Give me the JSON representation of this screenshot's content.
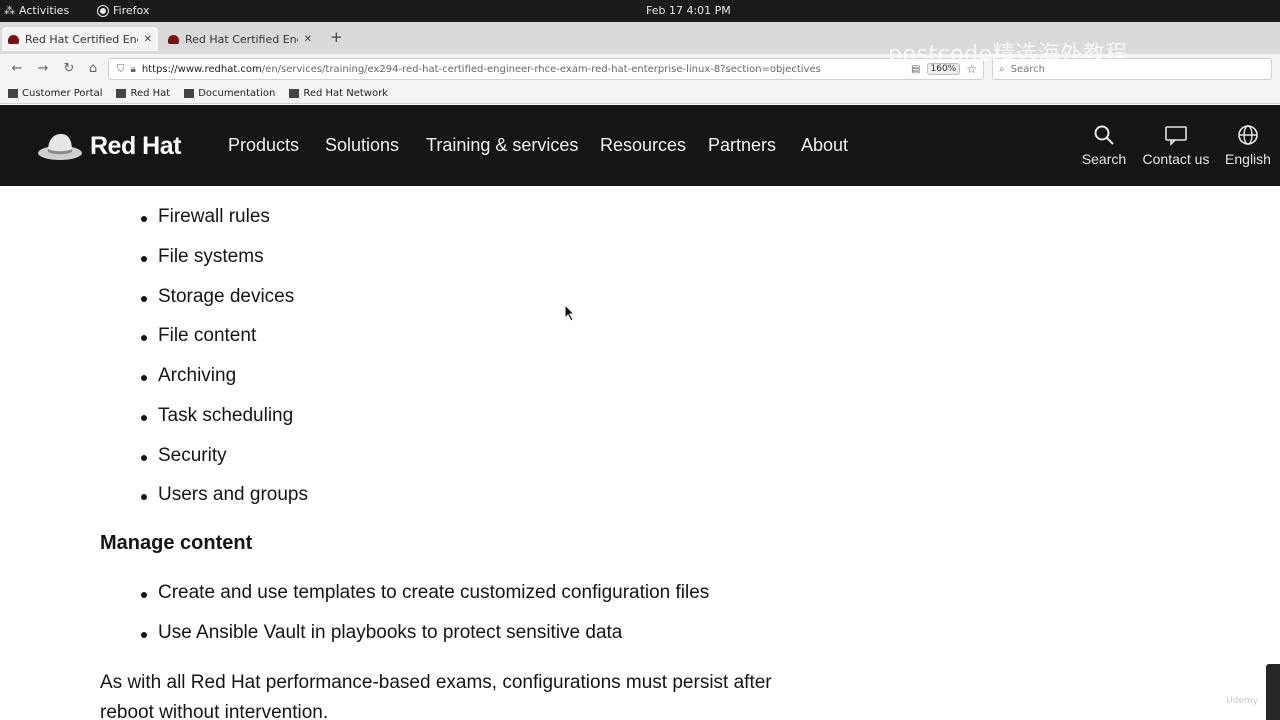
{
  "system_bar": {
    "activities": "Activities",
    "app_name": "Firefox",
    "clock": "Feb 17   4:01 PM"
  },
  "browser": {
    "tabs": [
      {
        "title": "Red Hat Certified Engineer",
        "active": true
      },
      {
        "title": "Red Hat Certified Engineer",
        "active": false
      }
    ],
    "url_domain": "https://www.redhat.com",
    "url_path": "/en/services/training/ex294-red-hat-certified-engineer-rhce-exam-red-hat-enterprise-linux-8?section=objectives",
    "zoom": "160%",
    "search_placeholder": "Search",
    "bookmarks": [
      "Customer Portal",
      "Red Hat",
      "Documentation",
      "Red Hat Network"
    ]
  },
  "masthead": {
    "brand": "Red Hat",
    "nav": [
      "Products",
      "Solutions",
      "Training & services",
      "Resources",
      "Partners",
      "About"
    ],
    "utilities": {
      "search": "Search",
      "contact": "Contact us",
      "language": "English"
    }
  },
  "content": {
    "list_top": [
      "Firewall rules",
      "File systems",
      "Storage devices",
      "File content",
      "Archiving",
      "Task scheduling",
      "Security",
      "Users and groups"
    ],
    "heading_manage": "Manage content",
    "list_manage": [
      "Create and use templates to create customized configuration files",
      "Use Ansible Vault in playbooks to protect sensitive data"
    ],
    "paragraph": "As with all Red Hat performance-based exams, configurations must persist after reboot without intervention."
  },
  "overlay": {
    "watermark": "postcode精选海外教程",
    "corner_mark": "Udemy"
  },
  "colors": {
    "masthead_bg": "#151515",
    "brand_red": "#ee0000",
    "topbar_bg": "#1b1b1b"
  }
}
